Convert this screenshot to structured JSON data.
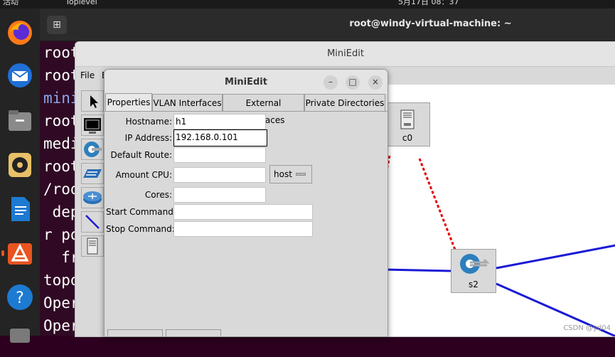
{
  "top_bar": {
    "activities": "活动",
    "app": "Toplevel",
    "clock": "5月17日  08：37"
  },
  "dock": {
    "items": [
      "firefox-icon",
      "thunderbird-icon",
      "files-icon",
      "rhythmbox-icon",
      "writer-icon",
      "appcenter-icon",
      "help-icon",
      "trash-icon"
    ]
  },
  "terminal": {
    "title": "root@windy-virtual-machine: ~",
    "new_tab": "⊞",
    "lines": [
      "root",
      "root",
      "mini",
      "root",
      "medi",
      "root",
      "/roo",
      " dep",
      "r po",
      "  fr",
      "topo",
      "Oper",
      "Oper"
    ]
  },
  "miniedit": {
    "title": "MiniEdit",
    "menu": {
      "file": "File",
      "edit": "E"
    },
    "tools": [
      "select-tool",
      "host-tool",
      "switch-tool",
      "legacy-switch-tool",
      "router-tool",
      "link-tool",
      "controller-tool"
    ],
    "nodes": {
      "controller": "c0",
      "switch": "s2"
    },
    "colors": {
      "link": "#1a1ad6",
      "control_link": "#e00000"
    }
  },
  "dialog": {
    "title": "MiniEdit",
    "buttons": {
      "minimize": "–",
      "maximize": "□",
      "close": "×"
    },
    "tabs": [
      "Properties",
      "VLAN Interfaces",
      "External Interfaces",
      "Private Directories"
    ],
    "fields": {
      "hostname": {
        "label": "Hostname:",
        "value": "h1"
      },
      "ip": {
        "label": "IP Address:",
        "value": "192.168.0.101"
      },
      "route": {
        "label": "Default Route:",
        "value": ""
      },
      "cpu": {
        "label": "Amount CPU:",
        "value": "",
        "option": "host"
      },
      "cores": {
        "label": "Cores:",
        "value": ""
      },
      "start": {
        "label": "Start Command:",
        "value": ""
      },
      "stop": {
        "label": "Stop Command:",
        "value": ""
      }
    }
  },
  "watermark": "CSDN @yd04"
}
